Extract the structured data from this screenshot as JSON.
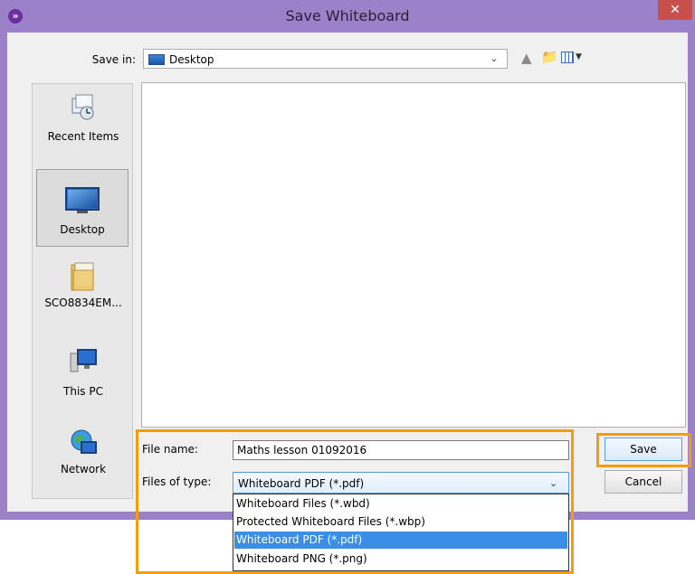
{
  "window": {
    "title": "Save Whiteboard",
    "close_glyph": "✕",
    "app_glyph": "»"
  },
  "toolbar": {
    "save_in_label": "Save in:",
    "save_in_value": "Desktop",
    "dropdown_glyph": "⌄",
    "icons": [
      "up-folder-icon",
      "new-folder-icon",
      "view-menu-icon"
    ]
  },
  "places": [
    {
      "label": "Recent Items",
      "icon": "recent-items-icon"
    },
    {
      "label": "Desktop",
      "icon": "desktop-icon",
      "selected": true
    },
    {
      "label": "SCO8834EM...",
      "icon": "user-folder-icon"
    },
    {
      "label": "This PC",
      "icon": "computer-icon"
    },
    {
      "label": "Network",
      "icon": "network-icon"
    }
  ],
  "form": {
    "file_name_label": "File name:",
    "file_name_value": "Maths lesson 01092016",
    "file_type_label": "Files of type:",
    "file_type_value": "Whiteboard PDF (*.pdf)",
    "file_type_options": [
      "Whiteboard Files (*.wbd)",
      "Protected Whiteboard Files (*.wbp)",
      "Whiteboard PDF (*.pdf)",
      "Whiteboard PNG (*.png)"
    ]
  },
  "buttons": {
    "save": "Save",
    "cancel": "Cancel"
  },
  "colors": {
    "title_bar": "#9b82c8",
    "highlight": "#f39c12",
    "selection": "#3a8ee6"
  }
}
